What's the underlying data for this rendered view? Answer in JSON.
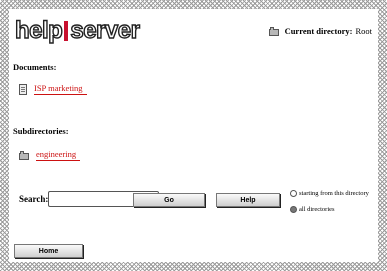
{
  "header": {
    "logo_left": "help",
    "logo_right": "server",
    "current_dir_label": "Current directory:",
    "current_dir_value": "Root"
  },
  "documents": {
    "title": "Documents:",
    "items": [
      {
        "label": "ISP marketing"
      }
    ]
  },
  "subdirectories": {
    "title": "Subdirectories:",
    "items": [
      {
        "label": "engineering"
      }
    ]
  },
  "search": {
    "label": "Search:",
    "value": "",
    "go_label": "Go",
    "help_label": "Help",
    "options": [
      {
        "label": "starting from this directory",
        "selected": false
      },
      {
        "label": "all directories",
        "selected": true
      }
    ]
  },
  "footer": {
    "home_label": "Home"
  },
  "colors": {
    "link": "#cc1111",
    "logo_bar": "#c8102e"
  },
  "icons": {
    "folder": "folder-icon",
    "document": "document-icon"
  }
}
